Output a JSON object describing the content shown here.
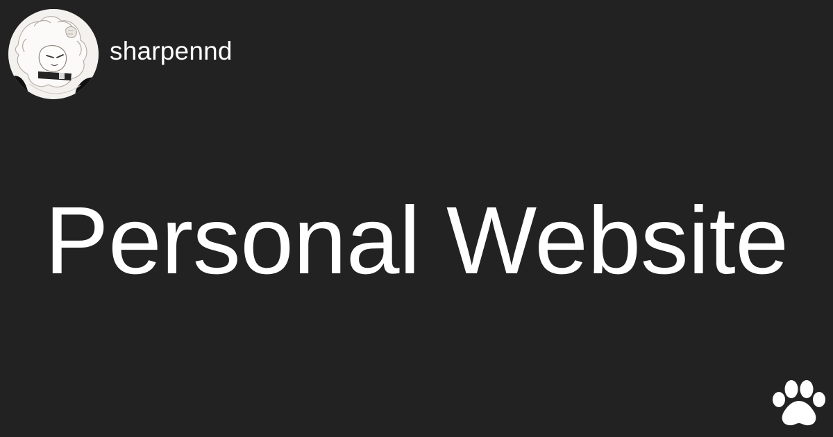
{
  "profile": {
    "username": "sharpennd"
  },
  "hero": {
    "title": "Personal Website"
  },
  "icons": {
    "avatar": "avatar",
    "brand": "paw-icon"
  },
  "colors": {
    "background": "#222222",
    "text": "#ffffff",
    "avatar_background": "#f3f1ee"
  }
}
